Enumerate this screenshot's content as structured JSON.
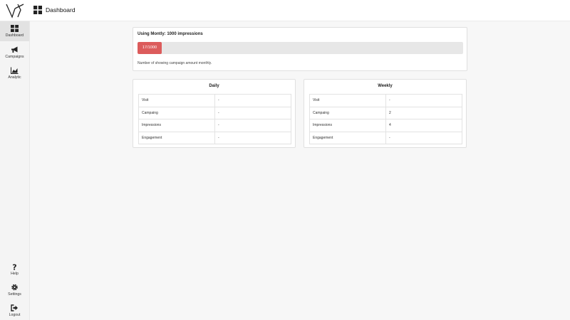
{
  "header": {
    "title": "Dashboard"
  },
  "sidebar": {
    "items": [
      {
        "label": "Dashboard"
      },
      {
        "label": "Campaigns"
      },
      {
        "label": "Analytic"
      }
    ],
    "bottom_items": [
      {
        "label": "Help"
      },
      {
        "label": "Settings"
      },
      {
        "label": "Logout"
      }
    ]
  },
  "usage": {
    "title": "Using Montly: 1000 impressions",
    "progress_text": "17/1000",
    "progress_value": 17,
    "progress_max": 1000,
    "note": "Number of showing campaign amount monthly."
  },
  "daily": {
    "title": "Daily",
    "rows": [
      {
        "key": "Visit",
        "value": "-"
      },
      {
        "key": "Campaing",
        "value": "-"
      },
      {
        "key": "Impressions",
        "value": "-"
      },
      {
        "key": "Engagement",
        "value": "-"
      }
    ]
  },
  "weekly": {
    "title": "Weekly",
    "rows": [
      {
        "key": "Visit",
        "value": "-"
      },
      {
        "key": "Campaing",
        "value": "2"
      },
      {
        "key": "Impressions",
        "value": "4"
      },
      {
        "key": "Engagement",
        "value": "-"
      }
    ]
  },
  "colors": {
    "accent": "#dc5c5c",
    "sidebar_active": "#e2e2e2",
    "background": "#f7f7f7"
  },
  "icons": {
    "logo": "vy-logo",
    "dashboard": "grid-icon",
    "campaigns": "megaphone-icon",
    "analytic": "bar-chart-icon",
    "help": "question-mark-icon",
    "settings": "gear-icon",
    "logout": "sign-out-icon"
  }
}
